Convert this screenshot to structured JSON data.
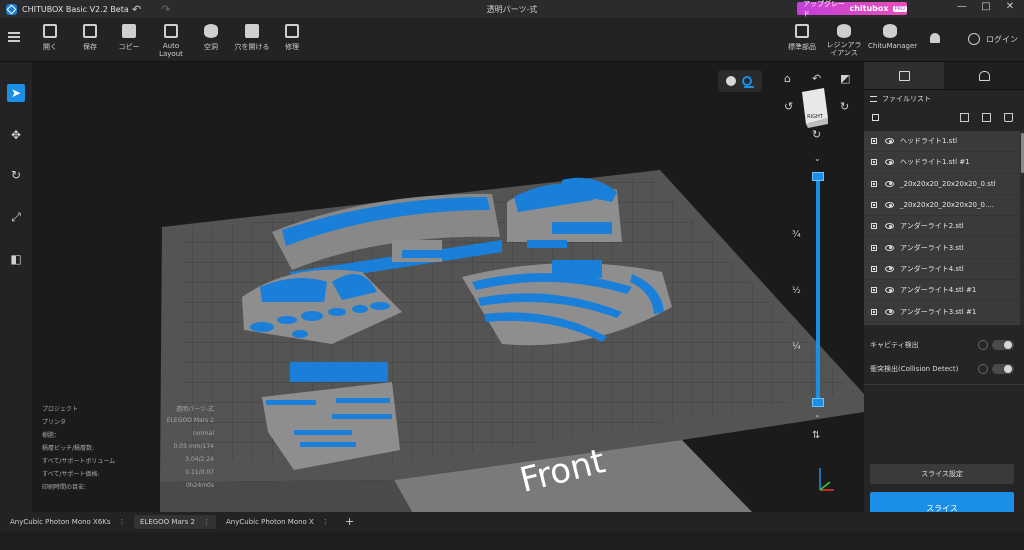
{
  "app": {
    "title": "CHITUBOX Basic V2.2 Beta",
    "project_title": "透明パーツ-式",
    "upgrade": {
      "label": "アップグレード",
      "brand": "chitubox",
      "tag": "PRO"
    },
    "window_buttons": {
      "minimize": "—",
      "maximize": "□",
      "close": "✕"
    },
    "undo_icon": "↶",
    "redo_icon": "↷"
  },
  "toolbar": {
    "items": [
      {
        "label": "開く",
        "icon": "folder-icon"
      },
      {
        "label": "保存",
        "icon": "save-icon"
      },
      {
        "label": "コピー",
        "icon": "copy-icon"
      },
      {
        "label": "Auto Layout",
        "icon": "auto-layout-icon"
      },
      {
        "label": "空洞",
        "icon": "hollow-icon"
      },
      {
        "label": "穴を開ける",
        "icon": "drill-icon"
      },
      {
        "label": "修理",
        "icon": "repair-icon"
      }
    ],
    "right_items": [
      {
        "label": "標準部品",
        "icon": "standard-parts-icon"
      },
      {
        "label": "レジンアライアンス",
        "icon": "resin-alliance-icon"
      },
      {
        "label": "ChituManager",
        "icon": "chitumanager-icon"
      }
    ],
    "login_label": "ログイン"
  },
  "left_tools": [
    {
      "name": "select-tool",
      "icon": "➤",
      "active": true
    },
    {
      "name": "move-tool",
      "icon": "✥",
      "active": false
    },
    {
      "name": "rotate-tool",
      "icon": "↻",
      "active": false
    },
    {
      "name": "scale-tool",
      "icon": "⤢",
      "active": false
    },
    {
      "name": "mirror-tool",
      "icon": "◧",
      "active": false
    }
  ],
  "viewport": {
    "front_label": "Front",
    "viewcube_face": "RIGHT",
    "slider_marks": [
      "¾",
      "½",
      "¼"
    ],
    "project_info": [
      {
        "label": "プロジェクト",
        "value": "透明パーツ-式"
      },
      {
        "label": "プリンタ",
        "value": "ELEGOO Mars 2"
      },
      {
        "label": "樹脂：",
        "value": "normal"
      },
      {
        "label": "積層ピッチ/積層数:",
        "value": "0.05 mm/174"
      },
      {
        "label": "すべて/サポートボリューム",
        "value": "3.04/2.24"
      },
      {
        "label": "すべて/サポート価格:",
        "value": "0.11/0.07"
      },
      {
        "label": "印刷時間の目安:",
        "value": "0h24m0s"
      }
    ]
  },
  "right_panel": {
    "file_list_title": "ファイルリスト",
    "files": [
      "ヘッドライト1.stl",
      "ヘッドライト1.stl #1",
      "_20x20x20_20x20x20_0.stl",
      "_20x20x20_20x20x20_0....",
      "アンダーライト2.stl",
      "アンダーライト3.stl",
      "アンダーライト4.stl",
      "アンダーライト4.stl #1",
      "アンダーライト3.stl #1"
    ],
    "cavity_detect": "キャビティ検出",
    "collision_detect": "衝突検出(Collision Detect)",
    "slice_settings": "スライス設定",
    "slice": "スライス"
  },
  "printer_tabs": [
    {
      "label": "AnyCubic Photon Mono X6Ks",
      "active": false
    },
    {
      "label": "ELEGOO Mars 2",
      "active": true
    },
    {
      "label": "AnyCubic Photon Mono X",
      "active": false
    }
  ],
  "printer_tab_add": "+",
  "colors": {
    "accent": "#1b8fe6",
    "model_blue": "#1a7fd8",
    "support_gray": "#8c8c8c",
    "plate": "#5a5a5a",
    "upgrade": "#d24bd0"
  }
}
